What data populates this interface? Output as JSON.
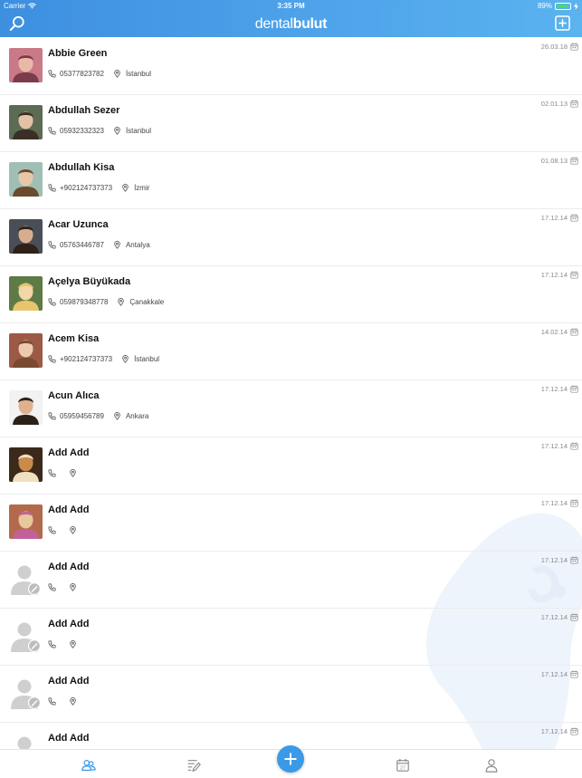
{
  "status_bar": {
    "carrier": "Carrier",
    "time": "3:35 PM",
    "battery": "89%",
    "battery_level": 0.89
  },
  "header": {
    "logo_prefix": "dental",
    "logo_suffix": "bulut"
  },
  "contacts": [
    {
      "name": "Abbie Green",
      "phone": "05377823782",
      "city": "İstanbul",
      "date": "26.03.18",
      "avatar": "photo"
    },
    {
      "name": "Abdullah Sezer",
      "phone": "05932332323",
      "city": "İstanbul",
      "date": "02.01.13",
      "avatar": "photo"
    },
    {
      "name": "Abdullah Kisa",
      "phone": "+902124737373",
      "city": "İzmir",
      "date": "01.08.13",
      "avatar": "photo"
    },
    {
      "name": "Acar Uzunca",
      "phone": "05763446787",
      "city": "Antalya",
      "date": "17.12.14",
      "avatar": "photo"
    },
    {
      "name": "Açelya Büyükada",
      "phone": "059879348778",
      "city": "Çanakkale",
      "date": "17.12.14",
      "avatar": "photo"
    },
    {
      "name": "Acem Kisa",
      "phone": "+902124737373",
      "city": "İstanbul",
      "date": "14.02.14",
      "avatar": "photo"
    },
    {
      "name": "Acun Alıca",
      "phone": "05959456789",
      "city": "Ankara",
      "date": "17.12.14",
      "avatar": "photo"
    },
    {
      "name": "Add Add",
      "phone": "",
      "city": "",
      "date": "17.12.14",
      "avatar": "photo"
    },
    {
      "name": "Add Add",
      "phone": "",
      "city": "",
      "date": "17.12.14",
      "avatar": "photo"
    },
    {
      "name": "Add Add",
      "phone": "",
      "city": "",
      "date": "17.12.14",
      "avatar": "placeholder"
    },
    {
      "name": "Add Add",
      "phone": "",
      "city": "",
      "date": "17.12.14",
      "avatar": "placeholder"
    },
    {
      "name": "Add Add",
      "phone": "",
      "city": "",
      "date": "17.12.14",
      "avatar": "placeholder"
    },
    {
      "name": "Add Add",
      "phone": "",
      "city": "",
      "date": "17.12.14",
      "avatar": "placeholder"
    }
  ],
  "tabbar": {
    "items": [
      {
        "icon": "patients-icon",
        "active": true
      },
      {
        "icon": "treatments-icon",
        "active": false
      },
      {
        "icon": "add-icon",
        "active": false
      },
      {
        "icon": "calendar-icon",
        "active": false
      },
      {
        "icon": "profile-icon",
        "active": false
      }
    ],
    "calendar_day": "27"
  },
  "colors": {
    "primary": "#3a9ae8",
    "header_start": "#3d8fe0",
    "header_end": "#5ab3ef",
    "active_tab": "#3a9ae8",
    "inactive_tab": "#8a8a8a"
  }
}
